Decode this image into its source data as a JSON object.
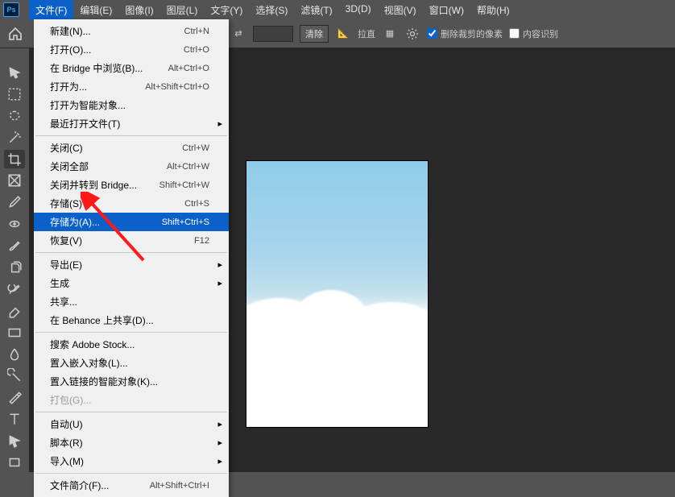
{
  "menubar": {
    "items": [
      "文件(F)",
      "编辑(E)",
      "图像(I)",
      "图层(L)",
      "文字(Y)",
      "选择(S)",
      "滤镜(T)",
      "3D(D)",
      "视图(V)",
      "窗口(W)",
      "帮助(H)"
    ]
  },
  "optionsbar": {
    "clear": "清除",
    "straighten": "拉直",
    "delete_cropped": "删除裁剪的像素",
    "content_aware": "内容识别"
  },
  "dropdown": [
    {
      "type": "item",
      "label": "新建(N)...",
      "shortcut": "Ctrl+N"
    },
    {
      "type": "item",
      "label": "打开(O)...",
      "shortcut": "Ctrl+O"
    },
    {
      "type": "item",
      "label": "在 Bridge 中浏览(B)...",
      "shortcut": "Alt+Ctrl+O"
    },
    {
      "type": "item",
      "label": "打开为...",
      "shortcut": "Alt+Shift+Ctrl+O"
    },
    {
      "type": "item",
      "label": "打开为智能对象..."
    },
    {
      "type": "item",
      "label": "最近打开文件(T)",
      "submenu": true
    },
    {
      "type": "sep"
    },
    {
      "type": "item",
      "label": "关闭(C)",
      "shortcut": "Ctrl+W"
    },
    {
      "type": "item",
      "label": "关闭全部",
      "shortcut": "Alt+Ctrl+W"
    },
    {
      "type": "item",
      "label": "关闭并转到 Bridge...",
      "shortcut": "Shift+Ctrl+W"
    },
    {
      "type": "item",
      "label": "存储(S)",
      "shortcut": "Ctrl+S"
    },
    {
      "type": "item",
      "label": "存储为(A)...",
      "shortcut": "Shift+Ctrl+S",
      "highlight": true
    },
    {
      "type": "item",
      "label": "恢复(V)",
      "shortcut": "F12"
    },
    {
      "type": "sep"
    },
    {
      "type": "item",
      "label": "导出(E)",
      "submenu": true
    },
    {
      "type": "item",
      "label": "生成",
      "submenu": true
    },
    {
      "type": "item",
      "label": "共享..."
    },
    {
      "type": "item",
      "label": "在 Behance 上共享(D)..."
    },
    {
      "type": "sep"
    },
    {
      "type": "item",
      "label": "搜索 Adobe Stock..."
    },
    {
      "type": "item",
      "label": "置入嵌入对象(L)..."
    },
    {
      "type": "item",
      "label": "置入链接的智能对象(K)..."
    },
    {
      "type": "item",
      "label": "打包(G)...",
      "disabled": true
    },
    {
      "type": "sep"
    },
    {
      "type": "item",
      "label": "自动(U)",
      "submenu": true
    },
    {
      "type": "item",
      "label": "脚本(R)",
      "submenu": true
    },
    {
      "type": "item",
      "label": "导入(M)",
      "submenu": true
    },
    {
      "type": "sep"
    },
    {
      "type": "item",
      "label": "文件简介(F)...",
      "shortcut": "Alt+Shift+Ctrl+I"
    }
  ],
  "tools": [
    "move",
    "marquee",
    "lasso",
    "magic-wand",
    "crop",
    "frame",
    "eyedropper",
    "healing",
    "brush",
    "clone",
    "history-brush",
    "eraser",
    "gradient",
    "blur",
    "dodge",
    "pen",
    "type",
    "path-select",
    "rectangle"
  ]
}
